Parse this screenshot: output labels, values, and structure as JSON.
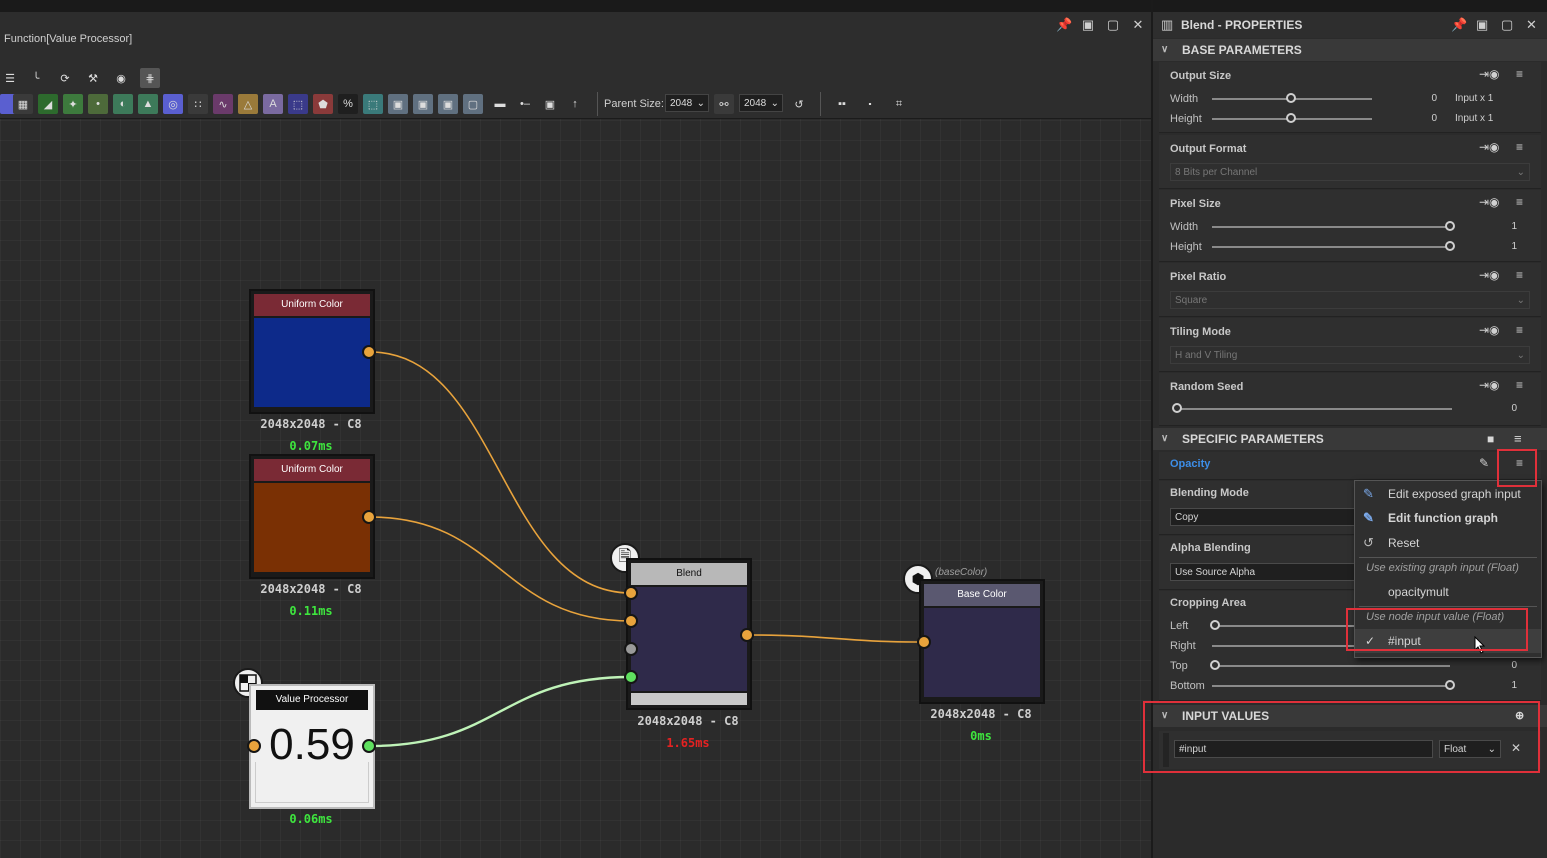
{
  "graph_window": {
    "function_label": "Function[Value Processor]",
    "parent_size_label": "Parent Size:",
    "parent_size_value": "2048",
    "size_value": "2048"
  },
  "nodes": {
    "uniform1": {
      "title": "Uniform Color",
      "res": "2048x2048 - C8",
      "time": "0.07ms",
      "color": "#0d2a8a",
      "title_bg": "#7a2a35"
    },
    "uniform2": {
      "title": "Uniform Color",
      "res": "2048x2048 - C8",
      "time": "0.11ms",
      "color": "#7a3004",
      "title_bg": "#7a2a35"
    },
    "value_processor": {
      "title": "Value Processor",
      "value": "0.59",
      "time": "0.06ms"
    },
    "blend": {
      "title": "Blend",
      "res": "2048x2048 - C8",
      "time": "1.65ms"
    },
    "base_color": {
      "tag": "(baseColor)",
      "title": "Base Color",
      "res": "2048x2048 - C8",
      "time": "0ms"
    }
  },
  "colors": {
    "time_ok": "#3ee53e",
    "time_slow": "#e52222",
    "accent_blue": "#3d8ee8",
    "highlight_red": "#e0303a",
    "link_orange": "#e8a33c",
    "link_green": "#bff3b8"
  },
  "panel": {
    "title": "Blend - PROPERTIES",
    "base_section": "BASE PARAMETERS",
    "output_size": {
      "label": "Output Size",
      "width_label": "Width",
      "height_label": "Height",
      "width_val": "0",
      "height_val": "0",
      "width_suffix": "Input x 1",
      "height_suffix": "Input x 1"
    },
    "output_format": {
      "label": "Output Format",
      "value": "8 Bits per Channel"
    },
    "pixel_size": {
      "label": "Pixel Size",
      "width_label": "Width",
      "height_label": "Height",
      "width_val": "1",
      "height_val": "1"
    },
    "pixel_ratio": {
      "label": "Pixel Ratio",
      "value": "Square"
    },
    "tiling_mode": {
      "label": "Tiling Mode",
      "value": "H and V Tiling"
    },
    "random_seed": {
      "label": "Random Seed",
      "value": "0"
    },
    "specific_section": "SPECIFIC PARAMETERS",
    "opacity_label": "Opacity",
    "blending_mode": {
      "label": "Blending Mode",
      "value": "Copy"
    },
    "alpha_blending": {
      "label": "Alpha Blending",
      "value": "Use Source Alpha"
    },
    "cropping": {
      "label": "Cropping Area",
      "left_label": "Left",
      "right_label": "Right",
      "top_label": "Top",
      "bottom_label": "Bottom",
      "top_val": "0",
      "bottom_val": "1"
    },
    "input_values_section": "INPUT VALUES",
    "input_name": "#input",
    "input_type": "Float"
  },
  "menu": {
    "items": [
      {
        "label": "Edit exposed graph input"
      },
      {
        "label": "Edit function graph"
      },
      {
        "label": "Reset"
      }
    ],
    "sec1": "Use existing graph input (Float)",
    "opt1": "opacitymult",
    "sec2": "Use node input value (Float)",
    "opt2": "#input"
  }
}
